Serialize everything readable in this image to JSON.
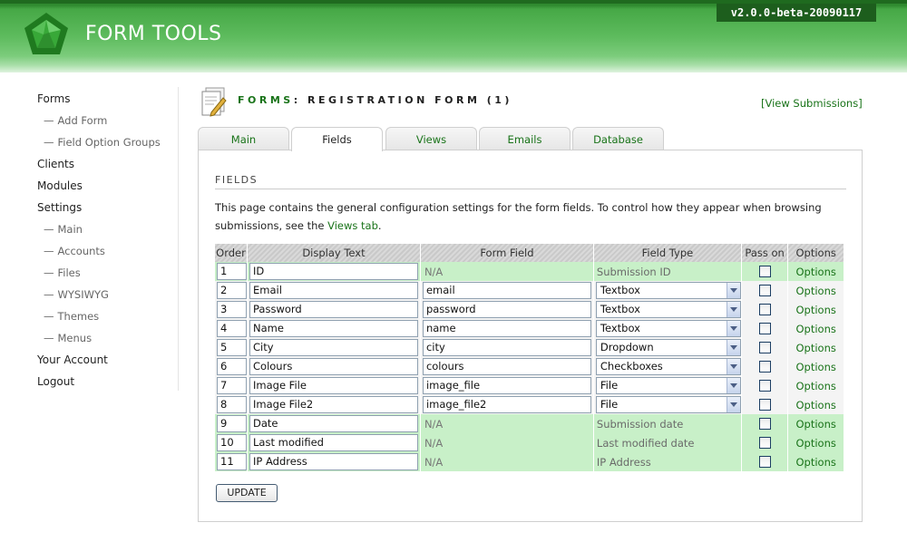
{
  "header": {
    "logo_text": "FORM TOOLS",
    "version": "v2.0.0-beta-20090117"
  },
  "sidebar": {
    "items": [
      {
        "label": "Forms",
        "sub": false
      },
      {
        "label": "Add Form",
        "sub": true
      },
      {
        "label": "Field Option Groups",
        "sub": true
      },
      {
        "label": "Clients",
        "sub": false
      },
      {
        "label": "Modules",
        "sub": false
      },
      {
        "label": "Settings",
        "sub": false
      },
      {
        "label": "Main",
        "sub": true
      },
      {
        "label": "Accounts",
        "sub": true
      },
      {
        "label": "Files",
        "sub": true
      },
      {
        "label": "WYSIWYG",
        "sub": true
      },
      {
        "label": "Themes",
        "sub": true
      },
      {
        "label": "Menus",
        "sub": true
      },
      {
        "label": "Your Account",
        "sub": false
      },
      {
        "label": "Logout",
        "sub": false
      }
    ],
    "sub_dash": "—"
  },
  "title": {
    "prefix": "FORMS",
    "separator": ":",
    "name": "REGISTRATION FORM (1)"
  },
  "view_submissions": "[View Submissions]",
  "tabs": [
    {
      "label": "Main",
      "active": false
    },
    {
      "label": "Fields",
      "active": true
    },
    {
      "label": "Views",
      "active": false
    },
    {
      "label": "Emails",
      "active": false
    },
    {
      "label": "Database",
      "active": false
    }
  ],
  "panel": {
    "heading": "FIELDS",
    "desc_before": "This page contains the general configuration settings for the form fields. To control how they appear when browsing submissions, see the ",
    "desc_link": "Views tab",
    "desc_after": "."
  },
  "table": {
    "headers": [
      "Order",
      "Display Text",
      "Form Field",
      "Field Type",
      "Pass on",
      "Options"
    ],
    "options_label": "Options",
    "rows": [
      {
        "order": "1",
        "display": "ID",
        "field": "N/A",
        "type": "Submission ID",
        "system": true
      },
      {
        "order": "2",
        "display": "Email",
        "field": "email",
        "type": "Textbox",
        "system": false
      },
      {
        "order": "3",
        "display": "Password",
        "field": "password",
        "type": "Textbox",
        "system": false
      },
      {
        "order": "4",
        "display": "Name",
        "field": "name",
        "type": "Textbox",
        "system": false
      },
      {
        "order": "5",
        "display": "City",
        "field": "city",
        "type": "Dropdown",
        "system": false
      },
      {
        "order": "6",
        "display": "Colours",
        "field": "colours",
        "type": "Checkboxes",
        "system": false
      },
      {
        "order": "7",
        "display": "Image File",
        "field": "image_file",
        "type": "File",
        "system": false
      },
      {
        "order": "8",
        "display": "Image File2",
        "field": "image_file2",
        "type": "File",
        "system": false
      },
      {
        "order": "9",
        "display": "Date",
        "field": "N/A",
        "type": "Submission date",
        "system": true
      },
      {
        "order": "10",
        "display": "Last modified",
        "field": "N/A",
        "type": "Last modified date",
        "system": true
      },
      {
        "order": "11",
        "display": "IP Address",
        "field": "N/A",
        "type": "IP Address",
        "system": true
      }
    ]
  },
  "update_button": "UPDATE",
  "colors": {
    "brand_green": "#197319",
    "header_green": "#46a846",
    "system_row": "#c8f0c8"
  }
}
